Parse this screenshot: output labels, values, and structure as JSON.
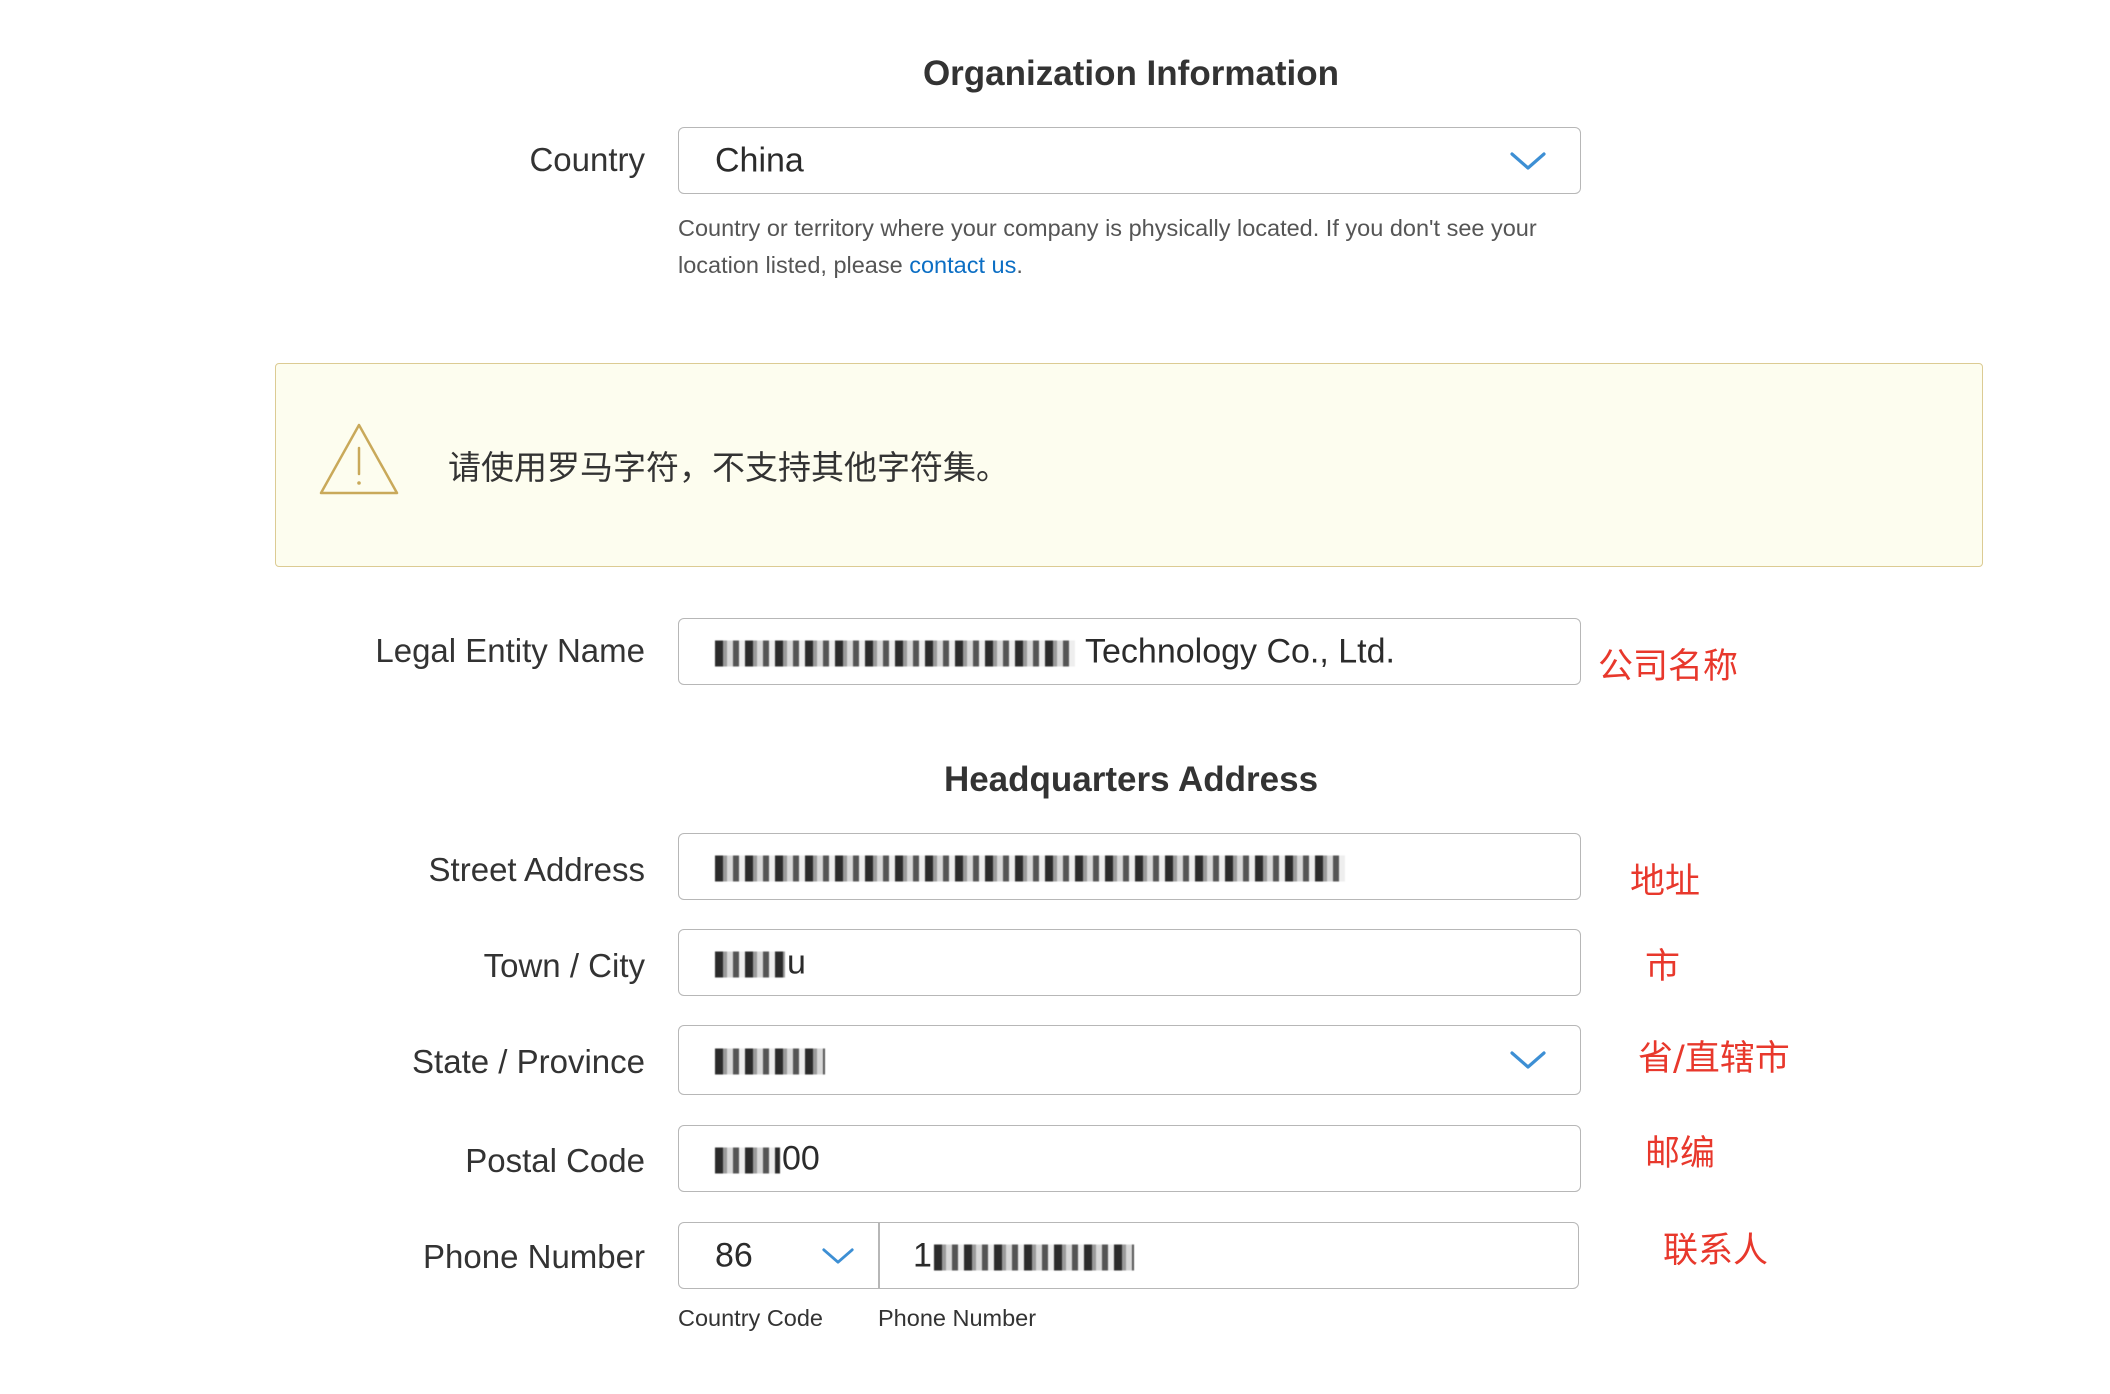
{
  "sections": {
    "organization_title": "Organization Information",
    "headquarters_title": "Headquarters Address"
  },
  "country": {
    "label": "Country",
    "value": "China",
    "help_text": "Country or territory where your company is physically located. If you don't see your location listed, please ",
    "help_link": "contact us",
    "help_suffix": "."
  },
  "warning": {
    "icon": "warning-triangle-icon",
    "text": "请使用罗马字符，不支持其他字符集。"
  },
  "legal_entity": {
    "label": "Legal Entity Name",
    "value_visible": "Technology Co., Ltd.",
    "annotation": "公司名称"
  },
  "street": {
    "label": "Street Address",
    "annotation": "地址"
  },
  "city": {
    "label": "Town / City",
    "value_visible": "u",
    "annotation": "市"
  },
  "state": {
    "label": "State / Province",
    "annotation": "省/直辖市"
  },
  "postal": {
    "label": "Postal Code",
    "value_visible": "00",
    "annotation": "邮编"
  },
  "phone": {
    "label": "Phone Number",
    "country_code": "86",
    "number_visible": "1",
    "country_code_label": "Country Code",
    "number_label": "Phone Number",
    "annotation": "联系人"
  },
  "colors": {
    "link": "#0b6ec4",
    "chevron": "#3d8fd4",
    "annotation": "#e8382c",
    "warning_bg": "#fdfdef",
    "warning_border": "#dccb93"
  }
}
